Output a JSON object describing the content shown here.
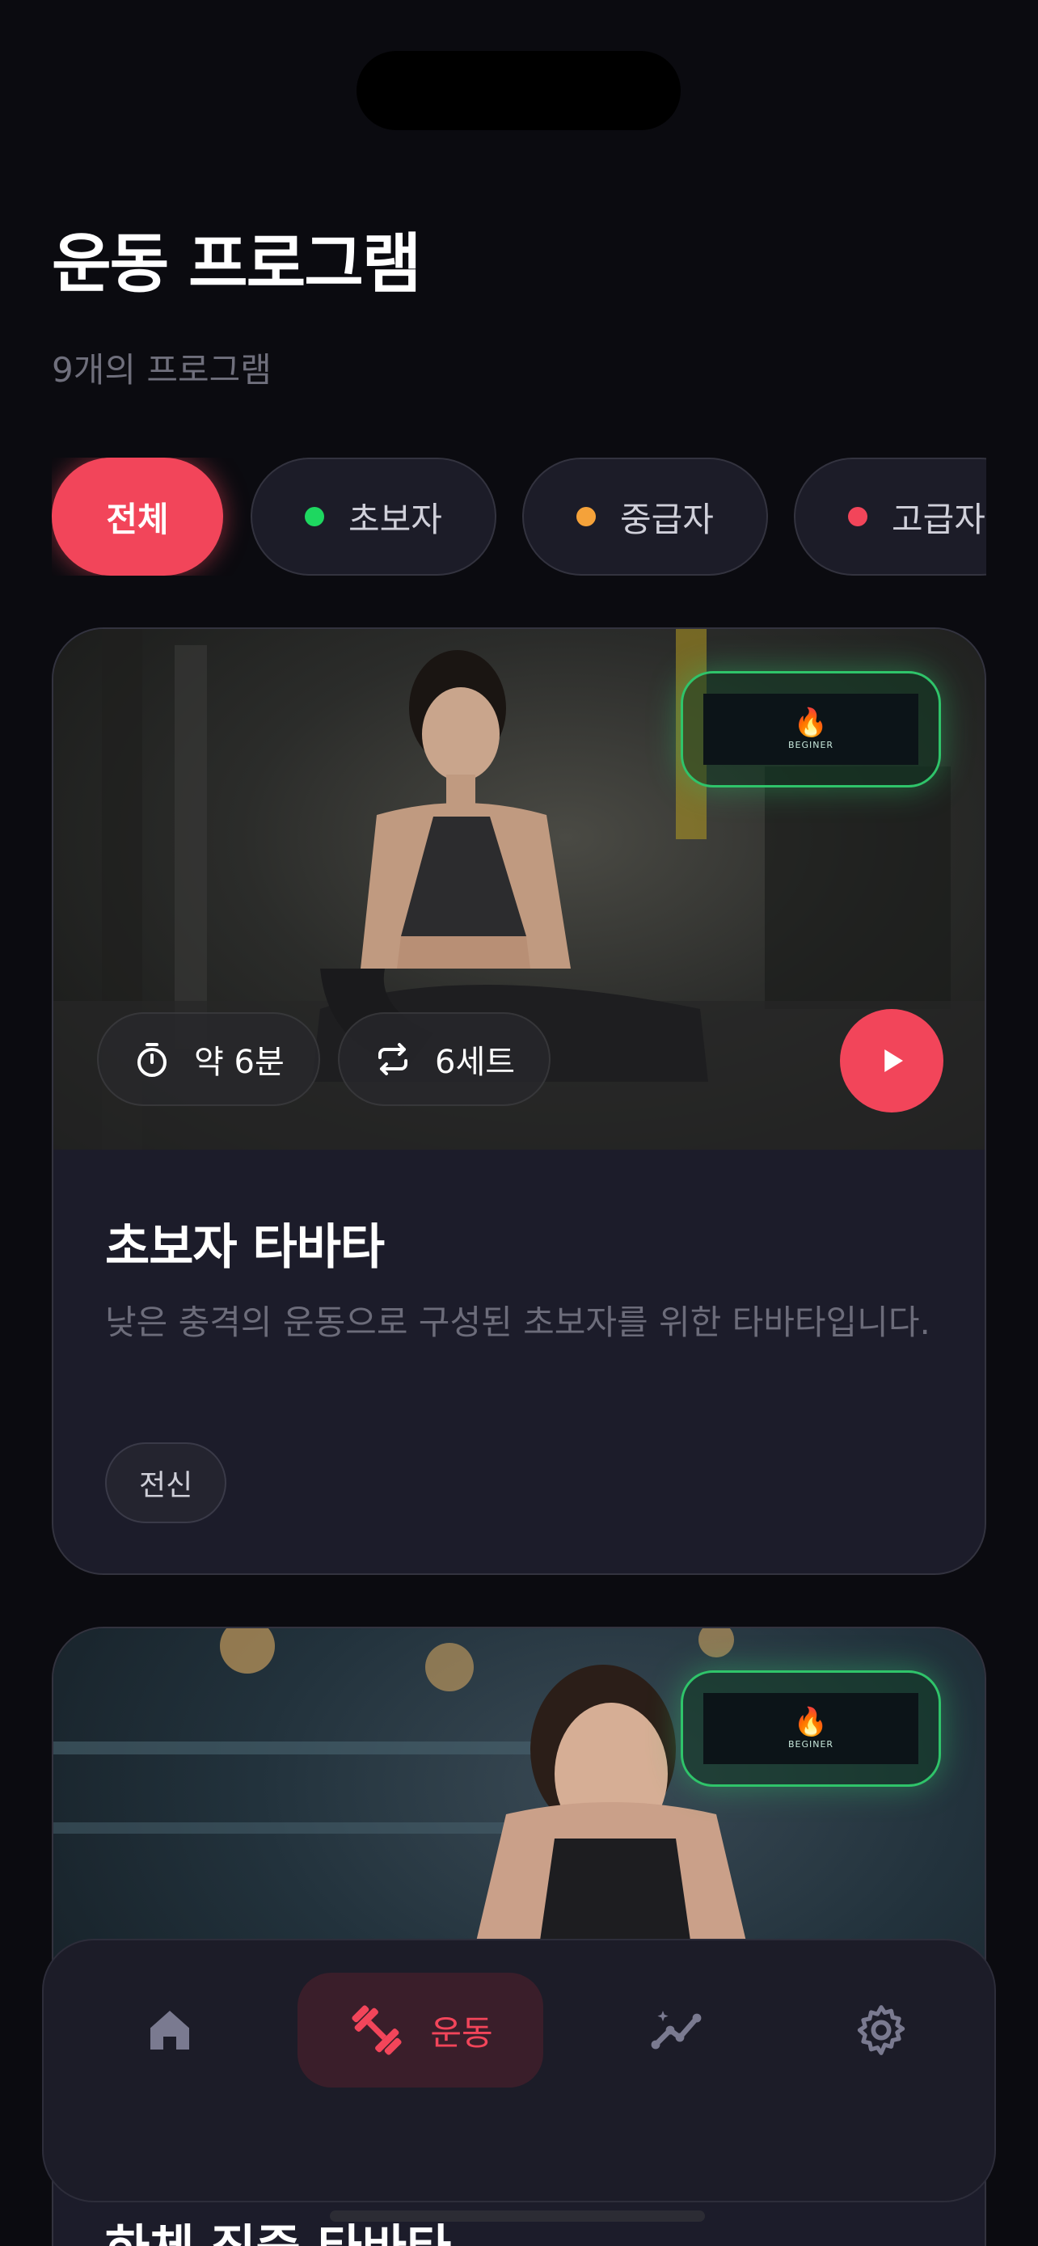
{
  "header": {
    "title": "운동 프로그램",
    "subtitle": "9개의 프로그램"
  },
  "filters": [
    {
      "label": "전체",
      "active": true
    },
    {
      "label": "초보자",
      "dot_color": "#1ed760"
    },
    {
      "label": "중급자",
      "dot_color": "#f5a23a"
    },
    {
      "label": "고급자",
      "dot_color": "#f2455a"
    }
  ],
  "programs": [
    {
      "title": "초보자 타바타",
      "description": "낮은 충격의 운동으로 구성된 초보자를 위한 타바타입니다.",
      "duration": "약 6분",
      "sets": "6세트",
      "tag": "전신",
      "badge": "BEGINER",
      "icons": [
        "timer-icon",
        "repeat-icon",
        "play-icon"
      ]
    },
    {
      "title": "하체 집중 타바타",
      "badge": "BEGINER"
    }
  ],
  "tabbar": {
    "items": [
      {
        "name": "home",
        "icon": "home-icon"
      },
      {
        "name": "workout",
        "icon": "dumbbell-icon",
        "label": "운동",
        "active": true
      },
      {
        "name": "stats",
        "icon": "chart-icon"
      },
      {
        "name": "settings",
        "icon": "gear-icon"
      }
    ]
  },
  "colors": {
    "accent": "#f2455a",
    "background": "#0b0b10",
    "card": "#1c1c2a",
    "beginner_badge": "#2fc46a"
  }
}
